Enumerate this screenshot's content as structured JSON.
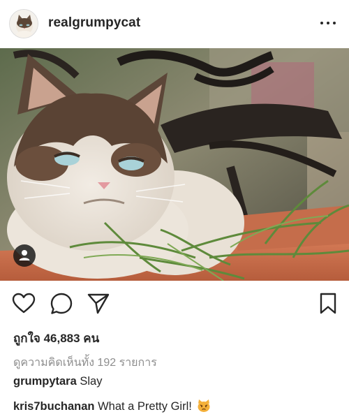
{
  "header": {
    "username": "realgrumpycat",
    "avatar_icon": "grumpy-cat-avatar",
    "more_icon": "more-options-icon"
  },
  "post": {
    "image_icon": "grumpy-cat-photo",
    "tag_icon": "user-tag-icon"
  },
  "actions": {
    "like_icon": "heart-icon",
    "comment_icon": "comment-icon",
    "share_icon": "send-icon",
    "save_icon": "bookmark-icon"
  },
  "likes_text": "ถูกใจ 46,883 คน",
  "view_comments_text": "ดูความคิดเห็นทั้ง 192 รายการ",
  "comments": [
    {
      "user": "grumpytara",
      "text": "Slay"
    },
    {
      "user": "kris7buchanan",
      "text": "What a Pretty Girl!",
      "emoji": "pouting-cat-emoji"
    }
  ],
  "colors": {
    "text": "#262626",
    "muted": "#8e8e8e",
    "pot": "#c96c4c"
  }
}
